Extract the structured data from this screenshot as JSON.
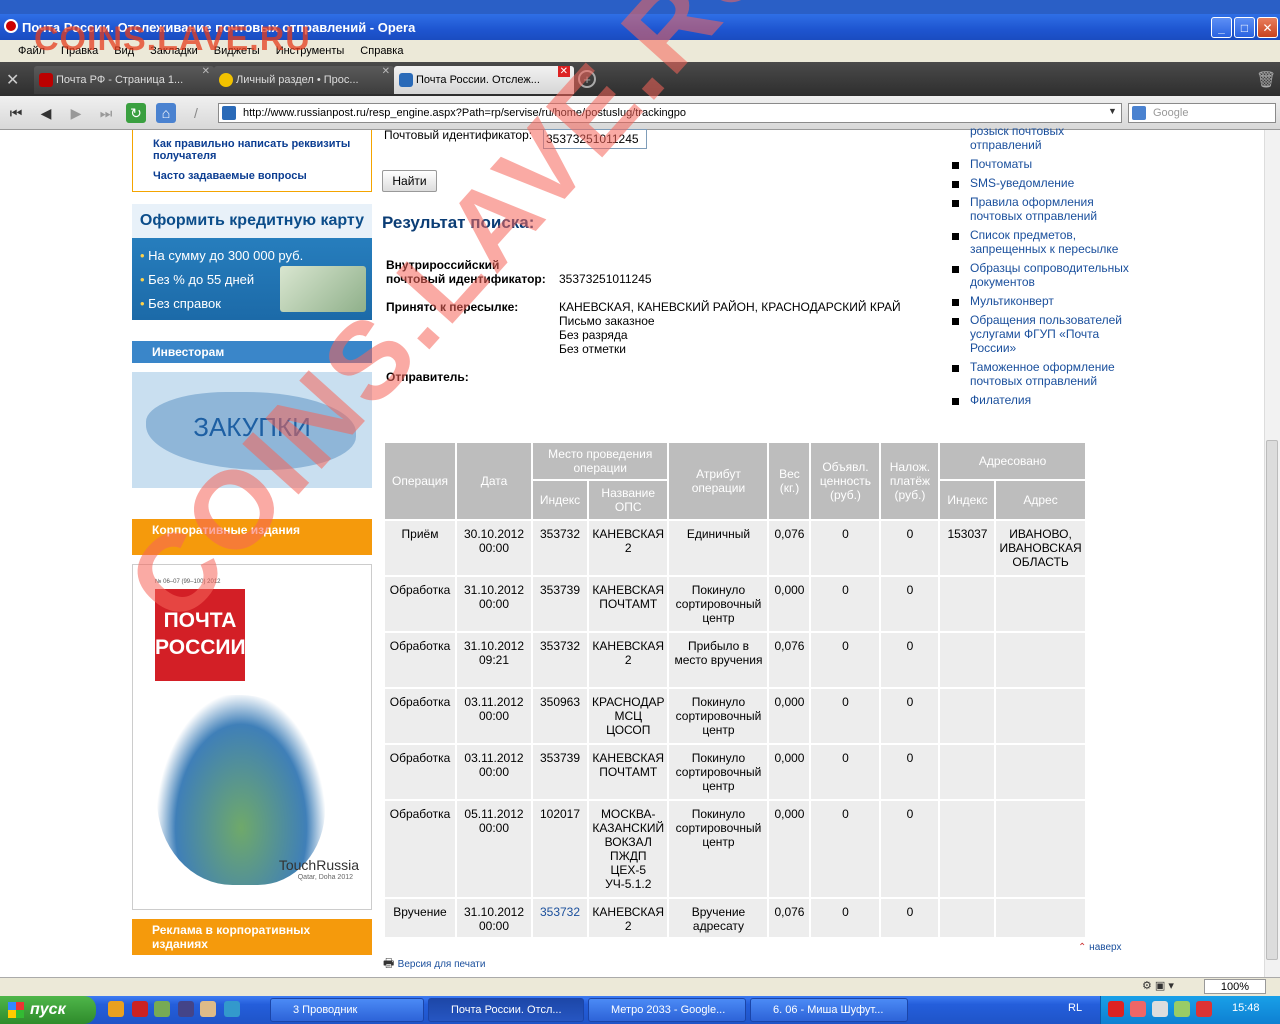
{
  "window": {
    "title": "Почта России. Отслеживание почтовых отправлений - Opera"
  },
  "menu": [
    "Файл",
    "Правка",
    "Вид",
    "Закладки",
    "Виджеты",
    "Инструменты",
    "Справка"
  ],
  "tabs": [
    {
      "label": "Почта РФ - Страница 1..."
    },
    {
      "label": "Личный раздел • Прос..."
    },
    {
      "label": "Почта России. Отслеж..."
    }
  ],
  "address": {
    "url": "http://www.russianpost.ru/resp_engine.aspx?Path=rp/servise/ru/home/postuslug/trackingpo",
    "search_placeholder": "Google"
  },
  "left": {
    "links": [
      "Как правильно написать реквизиты получателя",
      "Часто задаваемые вопросы"
    ],
    "credit": {
      "title": "Оформить кредитную карту",
      "items": [
        "На сумму до 300 000 руб.",
        "Без % до 55 дней",
        "Без справок"
      ]
    },
    "investors": "Инвесторам",
    "purchases": "ЗАКУПКИ",
    "corporate": "Корпоративные издания",
    "magazine": {
      "issue": "№ 06–07 (99–100) 2012",
      "line1": "ПОЧТА",
      "line2": "РОССИИ",
      "brand": "TouchRussia",
      "sub": "Qatar, Doha 2012"
    },
    "ads": "Реклама в корпоративных изданиях"
  },
  "form": {
    "label": "Почтовый идентификатор:",
    "value": "35373251011245",
    "button": "Найти"
  },
  "result": {
    "title": "Результат поиска:",
    "id_label_1": "Внутрироссийский",
    "id_label_2": "почтовый идентификатор:",
    "id_value": "35373251011245",
    "accepted_label": "Принято к пересылке:",
    "accepted_lines": [
      "КАНЕВСКАЯ, КАНЕВСКИЙ РАЙОН, КРАСНОДАРСКИЙ КРАЙ",
      "Письмо заказное",
      "Без разряда",
      "Без отметки"
    ],
    "sender_label": "Отправитель:"
  },
  "table": {
    "headers": {
      "operation": "Операция",
      "date": "Дата",
      "place": "Место проведения операции",
      "index": "Индекс",
      "ops_name": "Название ОПС",
      "attribute": "Атрибут операции",
      "weight": "Вес (кг.)",
      "declared": "Объявл. ценность (руб.)",
      "cod": "Налож. платёж (руб.)",
      "addressed": "Адресовано",
      "addr_index": "Индекс",
      "addr": "Адрес"
    },
    "rows": [
      {
        "op": "Приём",
        "date": "30.10.2012 00:00",
        "idx": "353732",
        "name": "КАНЕВСКАЯ 2",
        "attr": "Единичный",
        "w": "0,076",
        "dv": "0",
        "cod": "0",
        "aidx": "153037",
        "addr": "ИВАНОВО, ИВАНОВСКАЯ ОБЛАСТЬ"
      },
      {
        "op": "Обработка",
        "date": "31.10.2012 00:00",
        "idx": "353739",
        "name": "КАНЕВСКАЯ ПОЧТАМТ",
        "attr": "Покинуло сортировочный центр",
        "w": "0,000",
        "dv": "0",
        "cod": "0",
        "aidx": "",
        "addr": ""
      },
      {
        "op": "Обработка",
        "date": "31.10.2012 09:21",
        "idx": "353732",
        "name": "КАНЕВСКАЯ 2",
        "attr": "Прибыло в место вручения",
        "w": "0,076",
        "dv": "0",
        "cod": "0",
        "aidx": "",
        "addr": ""
      },
      {
        "op": "Обработка",
        "date": "03.11.2012 00:00",
        "idx": "350963",
        "name": "КРАСНОДАР МСЦ ЦОСОП",
        "attr": "Покинуло сортировочный центр",
        "w": "0,000",
        "dv": "0",
        "cod": "0",
        "aidx": "",
        "addr": ""
      },
      {
        "op": "Обработка",
        "date": "03.11.2012 00:00",
        "idx": "353739",
        "name": "КАНЕВСКАЯ ПОЧТАМТ",
        "attr": "Покинуло сортировочный центр",
        "w": "0,000",
        "dv": "0",
        "cod": "0",
        "aidx": "",
        "addr": ""
      },
      {
        "op": "Обработка",
        "date": "05.11.2012 00:00",
        "idx": "102017",
        "name": "МОСКВА-КАЗАНСКИЙ ВОКЗАЛ ПЖДП ЦЕХ-5 УЧ-5.1.2",
        "attr": "Покинуло сортировочный центр",
        "w": "0,000",
        "dv": "0",
        "cod": "0",
        "aidx": "",
        "addr": ""
      },
      {
        "op": "Вручение",
        "date": "31.10.2012 00:00",
        "idx": "353732",
        "name": "КАНЕВСКАЯ 2",
        "attr": "Вручение адресату",
        "w": "0,076",
        "dv": "0",
        "cod": "0",
        "aidx": "",
        "addr": ""
      }
    ]
  },
  "right_links": [
    "розыск почтовых отправлений",
    "Почтоматы",
    "SMS-уведомление",
    "Правила оформления почтовых отправлений",
    "Список предметов, запрещенных к пересылке",
    "Образцы сопроводительных документов",
    "Мультиконверт",
    "Обращения пользователей услугами ФГУП «Почта России»",
    "Таможенное оформление почтовых отправлений",
    "Филателия"
  ],
  "footer": {
    "back": "наверх",
    "print": "Версия для печати"
  },
  "watermark": {
    "top": "COINS.LAVE.RU",
    "diag": "COINS.LAVE.RU"
  },
  "status": {
    "zoom": "100%"
  },
  "taskbar": {
    "start": "пуск",
    "items": [
      "3 Проводник",
      "Почта России. Отсл...",
      "Метро 2033 - Google...",
      "6. 06 - Миша Шуфут..."
    ],
    "lang": "RL",
    "clock": "15:48"
  }
}
